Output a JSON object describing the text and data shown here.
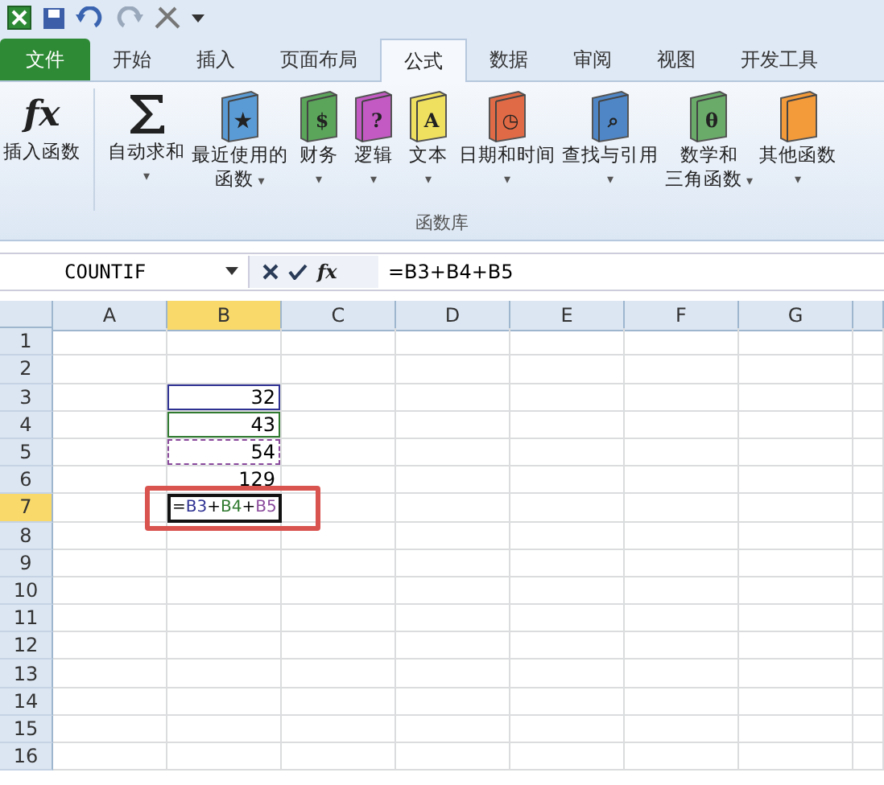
{
  "tabs": [
    {
      "label": "文件",
      "kind": "file",
      "selected": false
    },
    {
      "label": "开始",
      "kind": "tab",
      "selected": false
    },
    {
      "label": "插入",
      "kind": "tab",
      "selected": false
    },
    {
      "label": "页面布局",
      "kind": "tab",
      "selected": false
    },
    {
      "label": "公式",
      "kind": "tab",
      "selected": true
    },
    {
      "label": "数据",
      "kind": "tab",
      "selected": false
    },
    {
      "label": "审阅",
      "kind": "tab",
      "selected": false
    },
    {
      "label": "视图",
      "kind": "tab",
      "selected": false
    },
    {
      "label": "开发工具",
      "kind": "tab",
      "selected": false
    }
  ],
  "ribbon": {
    "group_label": "函数库",
    "buttons": [
      {
        "kind": "fx",
        "icon_text": "fx",
        "lines": [
          "插入函数"
        ]
      },
      {
        "kind": "sigma",
        "lines": [
          "自动求和"
        ],
        "caret": "▾"
      },
      {
        "kind": "book",
        "glyph": "★",
        "color": "#5b9bd5",
        "lines": [
          "最近使用的",
          "函数"
        ],
        "caret": "▾"
      },
      {
        "kind": "book",
        "glyph": "$",
        "color": "#5aa55a",
        "lines": [
          "财务"
        ],
        "caret": "▾"
      },
      {
        "kind": "book",
        "glyph": "?",
        "color": "#c35ac3",
        "lines": [
          "逻辑"
        ],
        "caret": "▾"
      },
      {
        "kind": "book",
        "glyph": "A",
        "color": "#f0e060",
        "lines": [
          "文本"
        ],
        "caret": "▾"
      },
      {
        "kind": "book",
        "glyph": "◷",
        "color": "#e06a45",
        "lines": [
          "日期和时间"
        ],
        "caret": "▾"
      },
      {
        "kind": "book",
        "glyph": "⌕",
        "color": "#4f86c6",
        "lines": [
          "查找与引用"
        ],
        "caret": "▾"
      },
      {
        "kind": "book",
        "glyph": "θ",
        "color": "#6aab6a",
        "lines": [
          "数学和",
          "三角函数"
        ],
        "caret": "▾"
      },
      {
        "kind": "book",
        "color": "#f39a3a",
        "lines": [
          "其他函数"
        ],
        "caret": "▾"
      }
    ]
  },
  "formula_bar": {
    "name_box": "COUNTIF",
    "fx_label": "fx",
    "formula": "=B3+B4+B5"
  },
  "sheet": {
    "columns": [
      {
        "label": "A",
        "selected": false
      },
      {
        "label": "B",
        "selected": true
      },
      {
        "label": "C",
        "selected": false
      },
      {
        "label": "D",
        "selected": false
      },
      {
        "label": "E",
        "selected": false
      },
      {
        "label": "F",
        "selected": false
      },
      {
        "label": "G",
        "selected": false
      }
    ],
    "rows": [
      {
        "header": "1",
        "selected": false
      },
      {
        "header": "2",
        "selected": false
      },
      {
        "header": "3",
        "selected": false,
        "column_b": {
          "value": "32",
          "color": "#2e3192",
          "dashed": false
        }
      },
      {
        "header": "4",
        "selected": false,
        "column_b": {
          "value": "43",
          "color": "#2f7a2f",
          "dashed": false
        }
      },
      {
        "header": "5",
        "selected": false,
        "column_b": {
          "value": "54",
          "color": "#8a4a9c",
          "dashed": true
        }
      },
      {
        "header": "6",
        "selected": false,
        "column_b": {
          "value": "129"
        }
      },
      {
        "header": "7",
        "selected": true,
        "column_b": {
          "editing": true,
          "highlighted": true,
          "parts": [
            {
              "text": "="
            },
            {
              "text": "B3",
              "color": "#2e3192"
            },
            {
              "text": "+"
            },
            {
              "text": "B4",
              "color": "#2f7a2f"
            },
            {
              "text": "+"
            },
            {
              "text": "B5",
              "color": "#8a4a9c"
            }
          ]
        }
      },
      {
        "header": "8",
        "selected": false
      },
      {
        "header": "9",
        "selected": false
      },
      {
        "header": "10",
        "selected": false
      },
      {
        "header": "11",
        "selected": false
      },
      {
        "header": "12",
        "selected": false
      },
      {
        "header": "13",
        "selected": false
      },
      {
        "header": "14",
        "selected": false
      },
      {
        "header": "15",
        "selected": false
      },
      {
        "header": "16",
        "selected": false
      }
    ]
  }
}
